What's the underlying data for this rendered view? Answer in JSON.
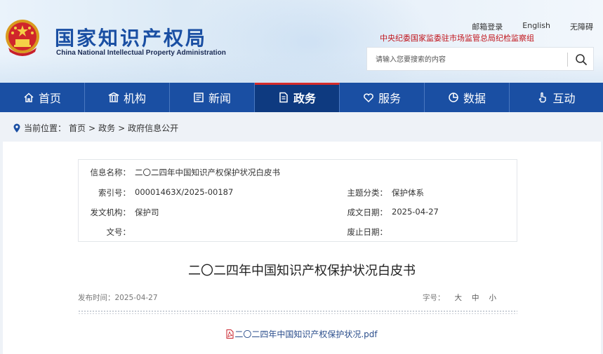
{
  "header": {
    "site_title": "国家知识产权局",
    "site_subtitle": "China National Intellectual Property Administration",
    "top_links": [
      "邮箱登录",
      "English",
      "无障碍"
    ],
    "jiwei_text": "中央纪委国家监委驻市场监管总局纪检监察组",
    "search_placeholder": "请输入您要搜索的内容"
  },
  "nav": {
    "items": [
      {
        "label": "首页",
        "icon": "home-icon"
      },
      {
        "label": "机构",
        "icon": "building-icon"
      },
      {
        "label": "新闻",
        "icon": "newspaper-icon"
      },
      {
        "label": "政务",
        "icon": "document-icon"
      },
      {
        "label": "服务",
        "icon": "heart-hand-icon"
      },
      {
        "label": "数据",
        "icon": "pie-chart-icon"
      },
      {
        "label": "互动",
        "icon": "hand-pointer-icon"
      }
    ],
    "active_index": 3,
    "accent_color": "#d52b2b",
    "bar_color": "#1a4fa3"
  },
  "breadcrumb": {
    "prefix": "当前位置：",
    "items": [
      "首页",
      "政务",
      "政府信息公开"
    ],
    "sep": ">"
  },
  "info": {
    "name_label": "信息名称：",
    "name_value": "二〇二四年中国知识产权保护状况白皮书",
    "index_label": "索引号：",
    "index_value": "00001463X/2025-00187",
    "topic_label": "主题分类：",
    "topic_value": "保护体系",
    "issuer_label": "发文机构：",
    "issuer_value": "保护司",
    "date_label": "成文日期：",
    "date_value": "2025-04-27",
    "docno_label": "文号：",
    "docno_value": "",
    "expire_label": "废止日期：",
    "expire_value": ""
  },
  "document": {
    "title": "二〇二四年中国知识产权保护状况白皮书",
    "publish_label": "发布时间：2025-04-27",
    "font_label": "字号：",
    "font_sizes": [
      "大",
      "中",
      "小"
    ],
    "attachment": "二〇二四年中国知识产权保护状况.pdf"
  }
}
